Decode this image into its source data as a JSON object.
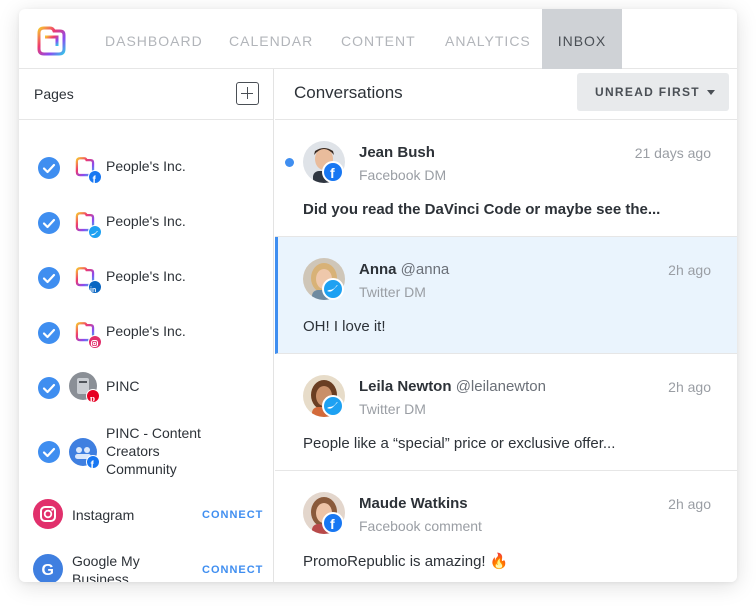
{
  "nav": {
    "items": [
      "DASHBOARD",
      "CALENDAR",
      "CONTENT",
      "ANALYTICS",
      "INBOX"
    ],
    "active": "INBOX"
  },
  "pages_panel": {
    "title": "Pages",
    "pages": [
      {
        "label": "People's Inc.",
        "network": "facebook",
        "checked": true
      },
      {
        "label": "People's Inc.",
        "network": "twitter",
        "checked": true
      },
      {
        "label": "People's Inc.",
        "network": "linkedin",
        "checked": true
      },
      {
        "label": "People's Inc.",
        "network": "instagram",
        "checked": true
      },
      {
        "label": "PINC",
        "network": "pinterest",
        "checked": true
      },
      {
        "label": "PINC - Content Creators Community",
        "network": "facebook",
        "checked": true
      }
    ],
    "connect_items": [
      {
        "label": "Instagram",
        "icon": "instagram-icon",
        "action": "CONNECT"
      },
      {
        "label": "Google My Business",
        "icon": "google-icon",
        "action": "CONNECT"
      }
    ]
  },
  "conversations_panel": {
    "title": "Conversations",
    "sort_label": "UNREAD FIRST",
    "items": [
      {
        "name": "Jean Bush",
        "handle": "",
        "channel": "Facebook DM",
        "time": "21 days ago",
        "message": "Did you read the DaVinci Code or maybe see the...",
        "unread": true,
        "network": "facebook"
      },
      {
        "name": "Anna",
        "handle": "@anna",
        "channel": "Twitter DM",
        "time": "2h ago",
        "message": "OH! I love it!",
        "unread": false,
        "network": "twitter",
        "selected": true
      },
      {
        "name": "Leila Newton",
        "handle": "@leilanewton",
        "channel": "Twitter DM",
        "time": "2h ago",
        "message": "People like a “special” price or exclusive offer...",
        "unread": false,
        "network": "twitter"
      },
      {
        "name": "Maude Watkins",
        "handle": "",
        "channel": "Facebook comment",
        "time": "2h ago",
        "message": "PromoRepublic is amazing! 🔥",
        "unread": false,
        "network": "facebook"
      }
    ]
  },
  "colors": {
    "accent": "#3f8ef0",
    "selected_row": "#eaf4fd",
    "facebook": "#1877f2",
    "twitter": "#1da1f2",
    "linkedin": "#0a66c2",
    "pinterest": "#e60023",
    "instagram": "#e1306c"
  }
}
